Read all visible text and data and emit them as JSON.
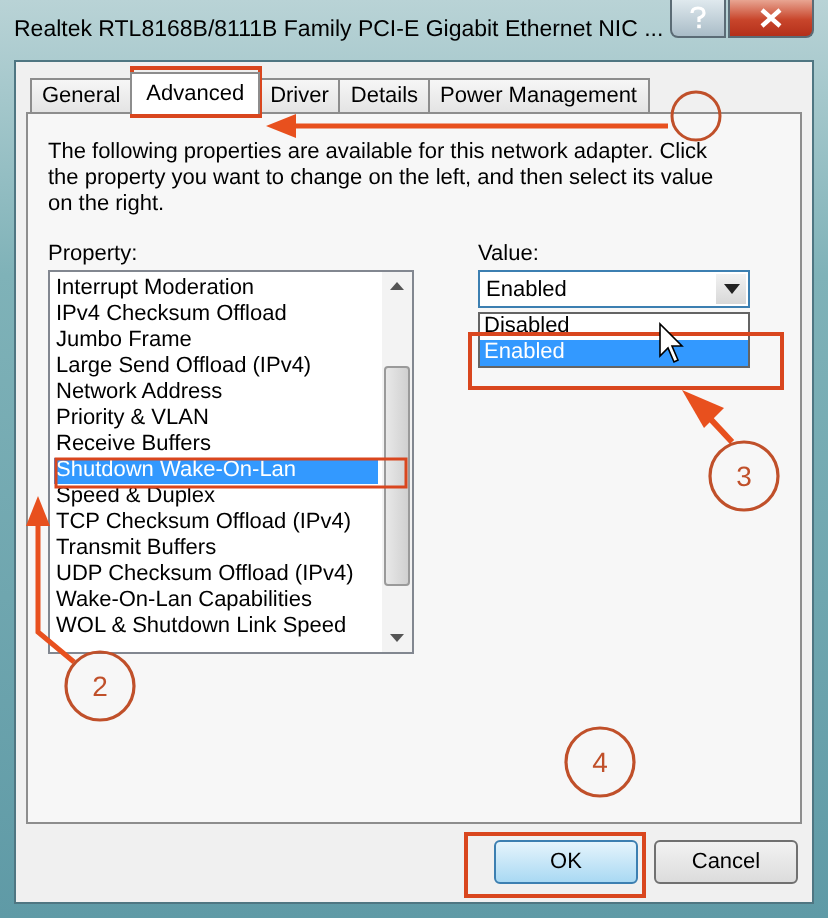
{
  "window": {
    "title": "Realtek RTL8168B/8111B Family PCI-E Gigabit Ethernet NIC ..."
  },
  "tabs": [
    {
      "label": "General",
      "selected": false
    },
    {
      "label": "Advanced",
      "selected": true
    },
    {
      "label": "Driver",
      "selected": false
    },
    {
      "label": "Details",
      "selected": false
    },
    {
      "label": "Power Management",
      "selected": false
    }
  ],
  "description": "The following properties are available for this network adapter. Click the property you want to change on the left, and then select its value on the right.",
  "property_label": "Property:",
  "properties": [
    {
      "label": "Interrupt Moderation",
      "selected": false
    },
    {
      "label": "IPv4 Checksum Offload",
      "selected": false
    },
    {
      "label": "Jumbo Frame",
      "selected": false
    },
    {
      "label": "Large Send Offload (IPv4)",
      "selected": false
    },
    {
      "label": "Network Address",
      "selected": false
    },
    {
      "label": "Priority & VLAN",
      "selected": false
    },
    {
      "label": "Receive Buffers",
      "selected": false
    },
    {
      "label": "Shutdown Wake-On-Lan",
      "selected": true
    },
    {
      "label": "Speed & Duplex",
      "selected": false
    },
    {
      "label": "TCP Checksum Offload (IPv4)",
      "selected": false
    },
    {
      "label": "Transmit Buffers",
      "selected": false
    },
    {
      "label": "UDP Checksum Offload (IPv4)",
      "selected": false
    },
    {
      "label": "Wake-On-Lan Capabilities",
      "selected": false
    },
    {
      "label": "WOL & Shutdown Link Speed",
      "selected": false
    }
  ],
  "value_label": "Value:",
  "value_combo": {
    "value": "Enabled",
    "expanded": true
  },
  "value_options": [
    {
      "label": "Disabled",
      "selected": false
    },
    {
      "label": "Enabled",
      "selected": true
    }
  ],
  "buttons": [
    {
      "label": "OK",
      "default": true
    },
    {
      "label": "Cancel",
      "default": false
    }
  ],
  "annotation_markers": [
    {
      "label": "2"
    },
    {
      "label": "3"
    },
    {
      "label": "4"
    }
  ]
}
